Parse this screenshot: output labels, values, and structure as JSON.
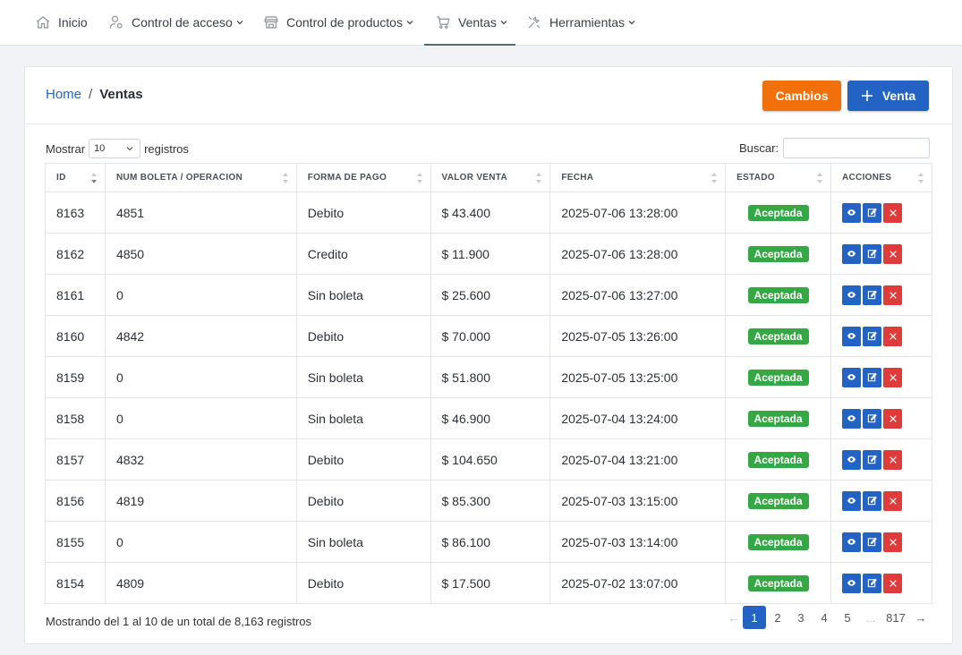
{
  "nav": {
    "items": [
      {
        "label": "Inicio",
        "icon": "home-icon"
      },
      {
        "label": "Control de acceso",
        "icon": "user-settings-icon"
      },
      {
        "label": "Control de productos",
        "icon": "store-icon"
      },
      {
        "label": "Ventas",
        "icon": "cart-icon"
      },
      {
        "label": "Herramientas",
        "icon": "tools-icon"
      }
    ]
  },
  "breadcrumb": {
    "home": "Home",
    "sep": "/",
    "current": "Ventas"
  },
  "buttons": {
    "cambios": "Cambios",
    "venta": "Venta"
  },
  "length": {
    "prefix": "Mostrar",
    "value": "10",
    "suffix": "registros"
  },
  "search": {
    "label": "Buscar:",
    "value": ""
  },
  "table": {
    "headers": [
      "ID",
      "NUM BOLETA / OPERACION",
      "FORMA DE PAGO",
      "VALOR VENTA",
      "FECHA",
      "ESTADO",
      "ACCIONES"
    ],
    "rows": [
      {
        "id": "8163",
        "boleta": "4851",
        "pago": "Debito",
        "valor": "$ 43.400",
        "fecha": "2025-07-06 13:28:00",
        "estado": "Aceptada"
      },
      {
        "id": "8162",
        "boleta": "4850",
        "pago": "Credito",
        "valor": "$ 11.900",
        "fecha": "2025-07-06 13:28:00",
        "estado": "Aceptada"
      },
      {
        "id": "8161",
        "boleta": "0",
        "pago": "Sin boleta",
        "valor": "$ 25.600",
        "fecha": "2025-07-06 13:27:00",
        "estado": "Aceptada"
      },
      {
        "id": "8160",
        "boleta": "4842",
        "pago": "Debito",
        "valor": "$ 70.000",
        "fecha": "2025-07-05 13:26:00",
        "estado": "Aceptada"
      },
      {
        "id": "8159",
        "boleta": "0",
        "pago": "Sin boleta",
        "valor": "$ 51.800",
        "fecha": "2025-07-05 13:25:00",
        "estado": "Aceptada"
      },
      {
        "id": "8158",
        "boleta": "0",
        "pago": "Sin boleta",
        "valor": "$ 46.900",
        "fecha": "2025-07-04 13:24:00",
        "estado": "Aceptada"
      },
      {
        "id": "8157",
        "boleta": "4832",
        "pago": "Debito",
        "valor": "$ 104.650",
        "fecha": "2025-07-04 13:21:00",
        "estado": "Aceptada"
      },
      {
        "id": "8156",
        "boleta": "4819",
        "pago": "Debito",
        "valor": "$ 85.300",
        "fecha": "2025-07-03 13:15:00",
        "estado": "Aceptada"
      },
      {
        "id": "8155",
        "boleta": "0",
        "pago": "Sin boleta",
        "valor": "$ 86.100",
        "fecha": "2025-07-03 13:14:00",
        "estado": "Aceptada"
      },
      {
        "id": "8154",
        "boleta": "4809",
        "pago": "Debito",
        "valor": "$ 17.500",
        "fecha": "2025-07-02 13:07:00",
        "estado": "Aceptada"
      }
    ]
  },
  "info": "Mostrando del 1 al 10 de un total de 8,163 registros",
  "pagination": {
    "prev": "←",
    "pages": [
      "1",
      "2",
      "3",
      "4",
      "5"
    ],
    "ellipsis": "...",
    "last": "817",
    "next": "→",
    "active": "1"
  },
  "colors": {
    "primary": "#2363c4",
    "orange": "#f2700c",
    "success": "#35a845",
    "danger": "#e03b3b"
  }
}
